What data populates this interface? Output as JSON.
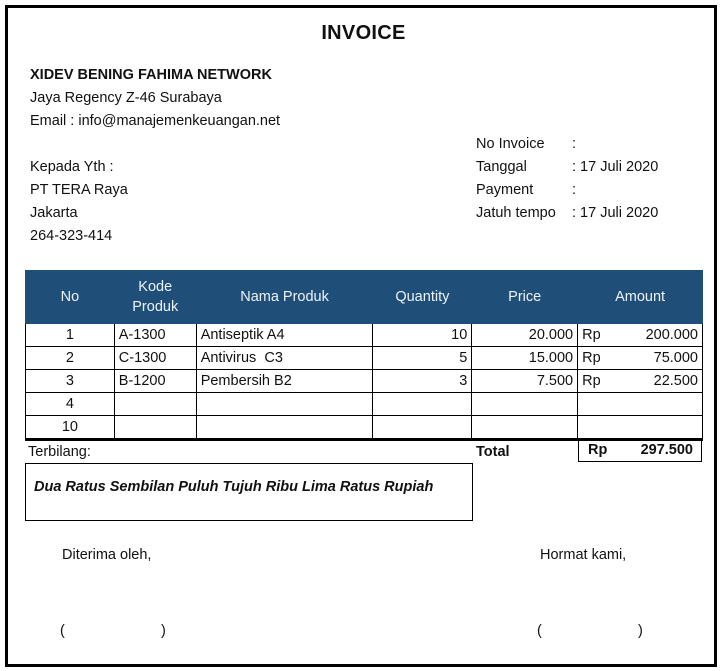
{
  "document": {
    "title": "INVOICE"
  },
  "sender": {
    "company": "XIDEV BENING FAHIMA NETWORK",
    "address": "Jaya Regency Z-46 Surabaya",
    "email": "Email : info@manajemenkeuangan.net"
  },
  "recipient": {
    "label": "Kepada Yth :",
    "name": "PT TERA Raya",
    "city": "Jakarta",
    "phone": "264-323-414"
  },
  "meta": [
    {
      "label": "No Invoice",
      "value": ":"
    },
    {
      "label": "Tanggal",
      "value": ": 17 Juli 2020"
    },
    {
      "label": "Payment",
      "value": ":"
    },
    {
      "label": "Jatuh tempo",
      "value": ": 17 Juli 2020"
    }
  ],
  "table": {
    "headers": {
      "no": "No",
      "kode_line1": "Kode",
      "kode_line2": "Produk",
      "nama": "Nama Produk",
      "quantity": "Quantity",
      "price": "Price",
      "amount": "Amount"
    },
    "rows": [
      {
        "no": "1",
        "kode": "A-1300",
        "nama": "Antiseptik A4",
        "qty": "10",
        "price": "20.000",
        "currency": "Rp",
        "amount": "200.000"
      },
      {
        "no": "2",
        "kode": "C-1300",
        "nama": "Antivirus  C3",
        "qty": "5",
        "price": "15.000",
        "currency": "Rp",
        "amount": "75.000"
      },
      {
        "no": "3",
        "kode": "B-1200",
        "nama": "Pembersih B2",
        "qty": "3",
        "price": "7.500",
        "currency": "Rp",
        "amount": "22.500"
      },
      {
        "no": "4",
        "kode": "",
        "nama": "",
        "qty": "",
        "price": "",
        "currency": "",
        "amount": ""
      },
      {
        "no": "10",
        "kode": "",
        "nama": "",
        "qty": "",
        "price": "",
        "currency": "",
        "amount": ""
      }
    ]
  },
  "summary": {
    "terbilang_label": "Terbilang:",
    "terbilang_text": "Dua Ratus Sembilan Puluh Tujuh Ribu Lima Ratus Rupiah",
    "total_label": "Total",
    "total_currency": "Rp",
    "total_value": "297.500"
  },
  "signatures": {
    "received_label": "Diterima oleh,",
    "regards_label": "Hormat kami,",
    "open_paren": "(",
    "close_paren": ")"
  }
}
